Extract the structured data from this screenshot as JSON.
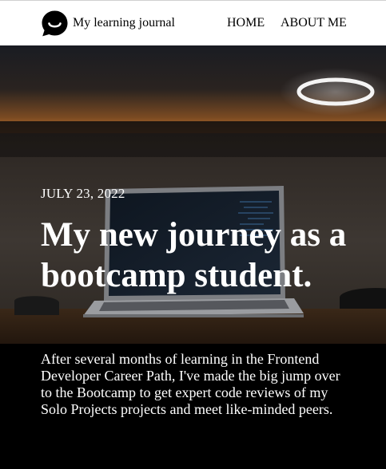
{
  "header": {
    "site_name": "My learning journal",
    "logo_icon": "chat-bubble-smile-icon",
    "nav": [
      {
        "label": "HOME"
      },
      {
        "label": "ABOUT ME"
      }
    ]
  },
  "hero": {
    "date": "JULY 23, 2022",
    "title": "My new journey as a bootcamp student.",
    "excerpt": "After several months of learning in the Frontend Developer Career Path, I've made the big jump over to the Bootcamp to get expert code reviews of my Solo Projects projects and meet like-minded peers."
  },
  "colors": {
    "header_bg": "#ffffff",
    "hero_bg": "#000000",
    "text_light": "#ffffff",
    "text_dark": "#000000"
  }
}
